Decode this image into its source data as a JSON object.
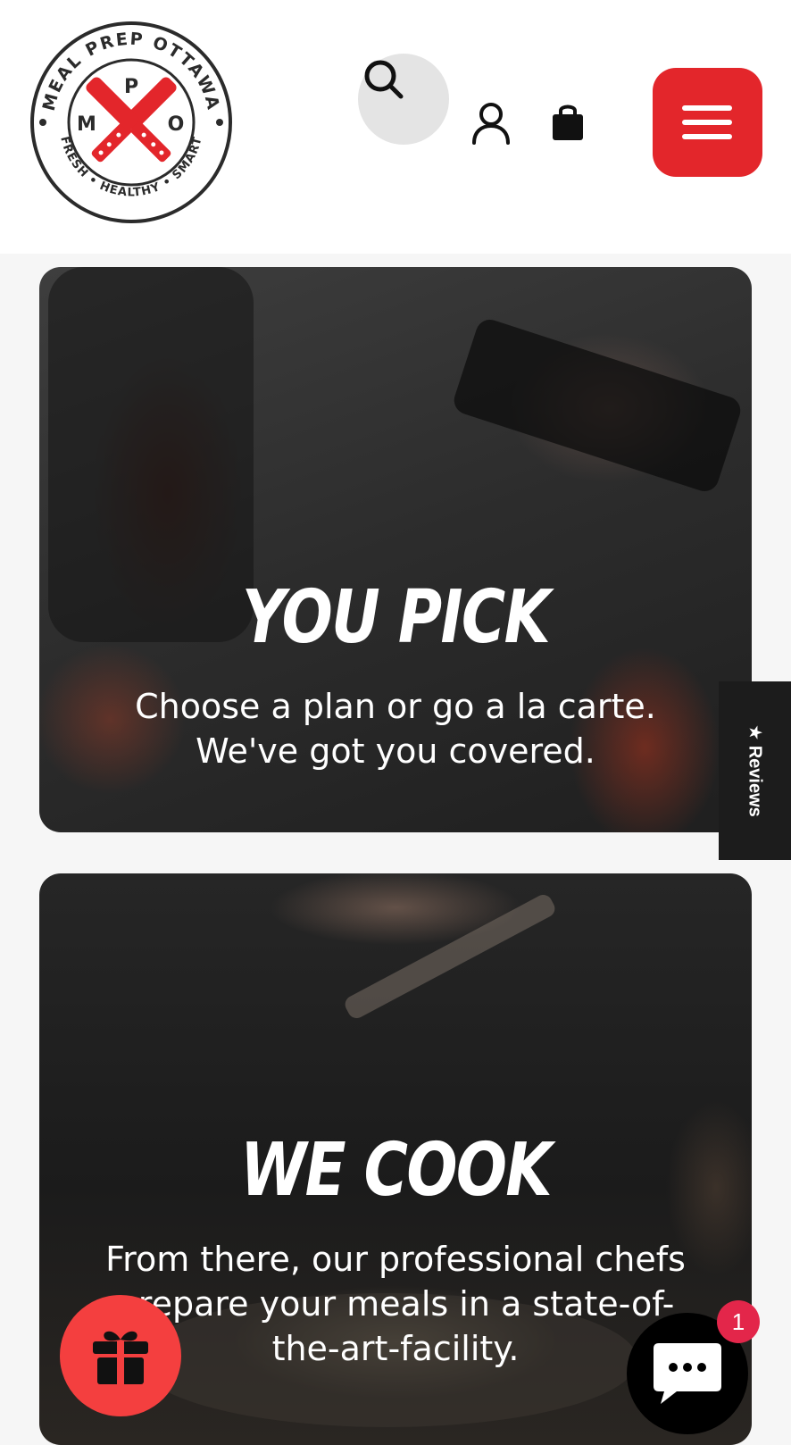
{
  "header": {
    "logo": {
      "top_text": "MEAL PREP OTTAWA",
      "bottom_text": "FRESH • HEALTHY • SMART",
      "letters": {
        "top": "P",
        "left": "M",
        "right": "O"
      }
    },
    "icons": {
      "search": "search-icon",
      "account": "account-icon",
      "cart": "shopping-bag-icon",
      "menu": "hamburger-menu-icon"
    }
  },
  "cards": [
    {
      "title": "YOU PICK",
      "text": "Choose a plan or go a la carte. We've got you covered."
    },
    {
      "title": "WE COOK",
      "text": "From there, our professional chefs prepare your meals in a state-of-the-art-facility."
    }
  ],
  "reviews_tab": {
    "label": "★ Reviews"
  },
  "floating": {
    "gift_icon": "gift-icon",
    "chat_icon": "chat-bubble-icon",
    "chat_badge": "1"
  },
  "colors": {
    "brand_red": "#e3262b",
    "gift_red": "#f43f3f",
    "badge_pink": "#e3264a",
    "reviews_bg": "#1c1c1c"
  }
}
